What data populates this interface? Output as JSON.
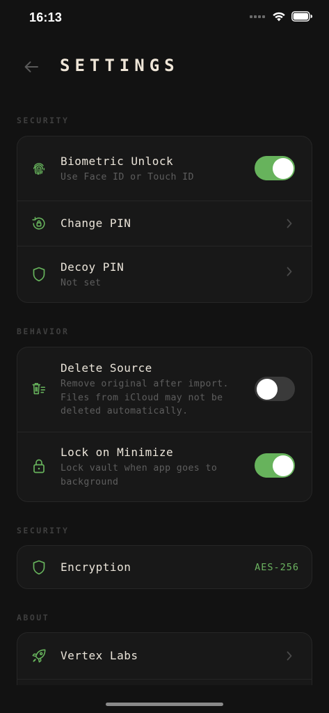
{
  "status_bar": {
    "time": "16:13"
  },
  "header": {
    "title": "SETTINGS"
  },
  "sections": {
    "security": {
      "label": "SECURITY",
      "biometric": {
        "title": "Biometric Unlock",
        "subtitle": "Use Face ID or Touch ID",
        "enabled": true
      },
      "change_pin": {
        "title": "Change PIN"
      },
      "decoy_pin": {
        "title": "Decoy PIN",
        "subtitle": "Not set"
      }
    },
    "behavior": {
      "label": "BEHAVIOR",
      "delete_source": {
        "title": "Delete Source",
        "subtitle_lines": [
          "Remove original after import.",
          "Files from iCloud may not be",
          "deleted automatically."
        ],
        "enabled": false
      },
      "lock_minimize": {
        "title": "Lock on Minimize",
        "subtitle_lines": [
          "Lock vault when app goes to",
          "background"
        ],
        "enabled": true
      }
    },
    "security2": {
      "label": "SECURITY",
      "encryption": {
        "title": "Encryption",
        "value": "AES-256"
      }
    },
    "about": {
      "label": "ABOUT",
      "vertex": {
        "title": "Vertex Labs"
      }
    }
  },
  "colors": {
    "accent": "#67b35c",
    "background": "#121212",
    "card": "#181818"
  }
}
